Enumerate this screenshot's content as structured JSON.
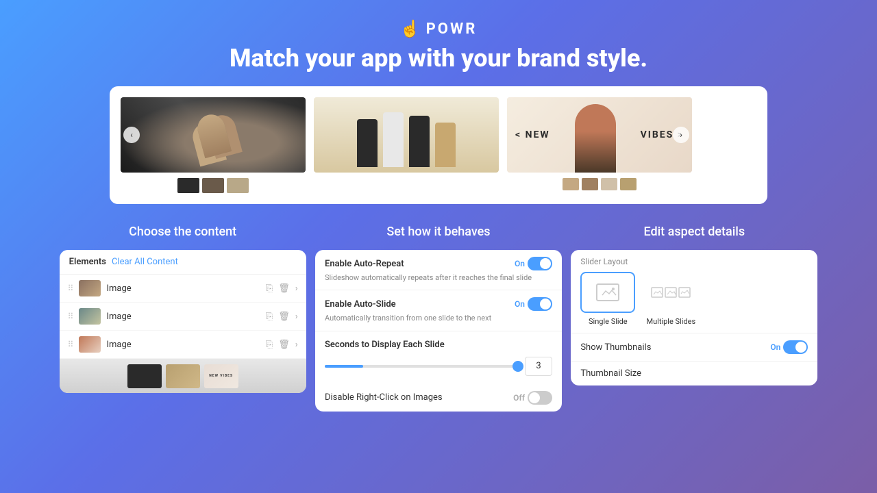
{
  "header": {
    "logo_text": "POWR",
    "tagline": "Match your app with your brand style."
  },
  "sections": {
    "content": {
      "title": "Choose the content",
      "elements_label": "Elements",
      "clear_label": "Clear All Content",
      "items": [
        {
          "label": "Image"
        },
        {
          "label": "Image"
        },
        {
          "label": "Image"
        }
      ]
    },
    "behavior": {
      "title": "Set how it behaves",
      "auto_repeat": {
        "label": "Enable Auto-Repeat",
        "desc": "Slideshow automatically repeats after it reaches the final slide",
        "toggle_text": "On",
        "enabled": true
      },
      "auto_slide": {
        "label": "Enable Auto-Slide",
        "desc": "Automatically transition from one slide to the next",
        "toggle_text": "On",
        "enabled": true
      },
      "seconds": {
        "label": "Seconds to Display Each Slide",
        "value": "3"
      },
      "disable_right_click": {
        "label": "Disable Right-Click on Images",
        "toggle_text": "Off",
        "enabled": false
      }
    },
    "aspect": {
      "title": "Edit aspect details",
      "slider_layout": {
        "label": "Slider Layout",
        "single_slide": "Single Slide",
        "multiple_slides": "Multiple Slides"
      },
      "show_thumbnails": {
        "label": "Show Thumbnails",
        "toggle_text": "On",
        "enabled": true
      },
      "thumbnail_size": {
        "label": "Thumbnail Size"
      }
    }
  }
}
